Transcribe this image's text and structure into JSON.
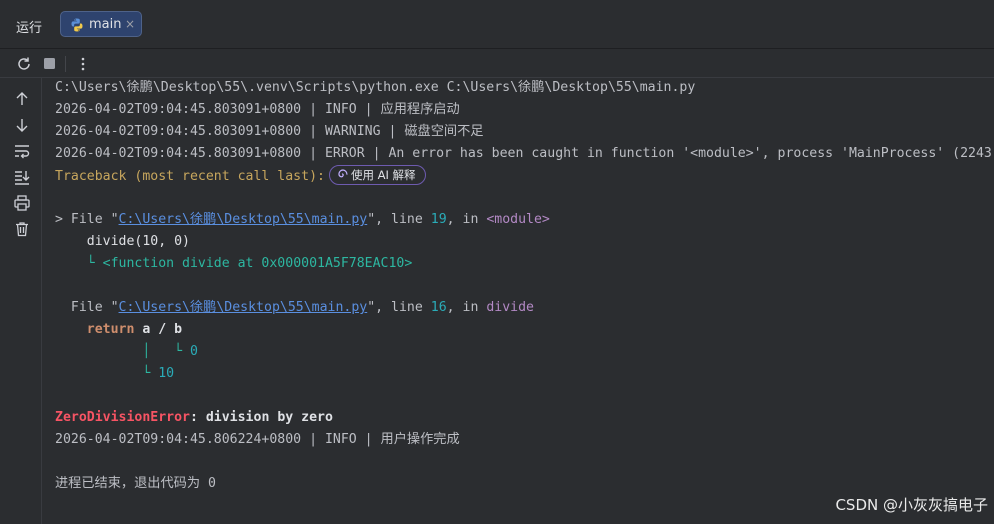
{
  "header": {
    "run_label": "运行",
    "tab": {
      "label": "main",
      "close": "×"
    }
  },
  "icons": {
    "rerun": "rerun-icon",
    "stop": "stop-icon",
    "more": "more-icon",
    "up": "arrow-up-icon",
    "down": "arrow-down-icon",
    "wrap": "soft-wrap-icon",
    "scroll": "scroll-to-end-icon",
    "print": "print-icon",
    "trash": "trash-icon"
  },
  "console": {
    "cmd": "C:\\Users\\徐鹏\\Desktop\\55\\.venv\\Scripts\\python.exe C:\\Users\\徐鹏\\Desktop\\55\\main.py",
    "log1": "2026-04-02T09:04:45.803091+0800 | INFO | 应用程序启动",
    "log2": "2026-04-02T09:04:45.803091+0800 | WARNING | 磁盘空间不足",
    "log3": "2026-04-02T09:04:45.803091+0800 | ERROR | An error has been caught in function '<module>', process 'MainProcess' (2243",
    "traceback": "Traceback (most recent call last):",
    "ai_button": "使用 AI 解释",
    "frame1": {
      "prefix": "> File \"",
      "path": "C:\\Users\\徐鹏\\Desktop\\55\\main.py",
      "mid": "\", line ",
      "line_no": "19",
      "in": ", in ",
      "func": "<module>",
      "code": "    divide(10, 0)",
      "var_tree": "    └ ",
      "var_value": "<function divide at 0x000001A5F78EAC10>"
    },
    "frame2": {
      "prefix": "  File \"",
      "path": "C:\\Users\\徐鹏\\Desktop\\55\\main.py",
      "mid": "\", line ",
      "line_no": "16",
      "in": ", in ",
      "func": "divide",
      "code_kw": "    return",
      "code_rest": " a / b",
      "var1_tree": "           │   └ ",
      "var1_value": "0",
      "var2_tree": "           └ ",
      "var2_value": "10"
    },
    "error_name": "ZeroDivisionError",
    "error_msg": ": division by zero",
    "log4": "2026-04-02T09:04:45.806224+0800 | INFO | 用户操作完成",
    "exit": "进程已结束，退出代码为 0"
  },
  "watermark": "CSDN @小灰灰搞电子"
}
